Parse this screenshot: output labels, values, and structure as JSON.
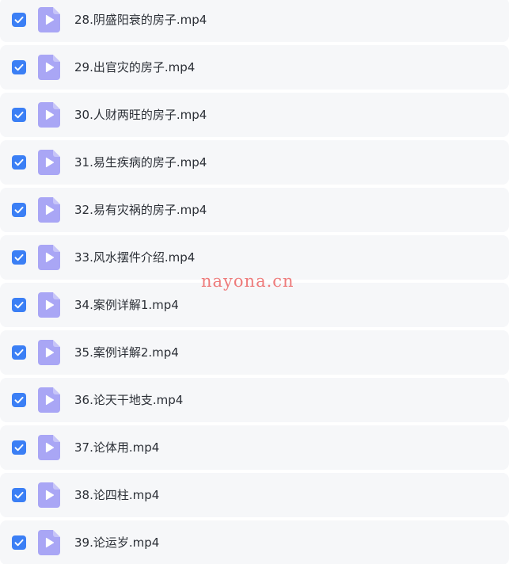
{
  "colors": {
    "row_background": "#f6f7f9",
    "checkbox_checked": "#3b7ff5",
    "video_icon": "#a9a6f5",
    "watermark": "#ee7b7b",
    "text": "#2b2f36"
  },
  "files": [
    {
      "name": "28.阴盛阳衰的房子.mp4",
      "checked": true,
      "icon": "video-file-icon"
    },
    {
      "name": "29.出官灾的房子.mp4",
      "checked": true,
      "icon": "video-file-icon"
    },
    {
      "name": "30.人财两旺的房子.mp4",
      "checked": true,
      "icon": "video-file-icon"
    },
    {
      "name": "31.易生疾病的房子.mp4",
      "checked": true,
      "icon": "video-file-icon"
    },
    {
      "name": "32.易有灾祸的房子.mp4",
      "checked": true,
      "icon": "video-file-icon"
    },
    {
      "name": "33.风水摆件介绍.mp4",
      "checked": true,
      "icon": "video-file-icon"
    },
    {
      "name": "34.案例详解1.mp4",
      "checked": true,
      "icon": "video-file-icon"
    },
    {
      "name": "35.案例详解2.mp4",
      "checked": true,
      "icon": "video-file-icon"
    },
    {
      "name": "36.论天干地支.mp4",
      "checked": true,
      "icon": "video-file-icon"
    },
    {
      "name": "37.论体用.mp4",
      "checked": true,
      "icon": "video-file-icon"
    },
    {
      "name": "38.论四柱.mp4",
      "checked": true,
      "icon": "video-file-icon"
    },
    {
      "name": "39.论运岁.mp4",
      "checked": true,
      "icon": "video-file-icon"
    }
  ],
  "watermark": "nayona.cn"
}
